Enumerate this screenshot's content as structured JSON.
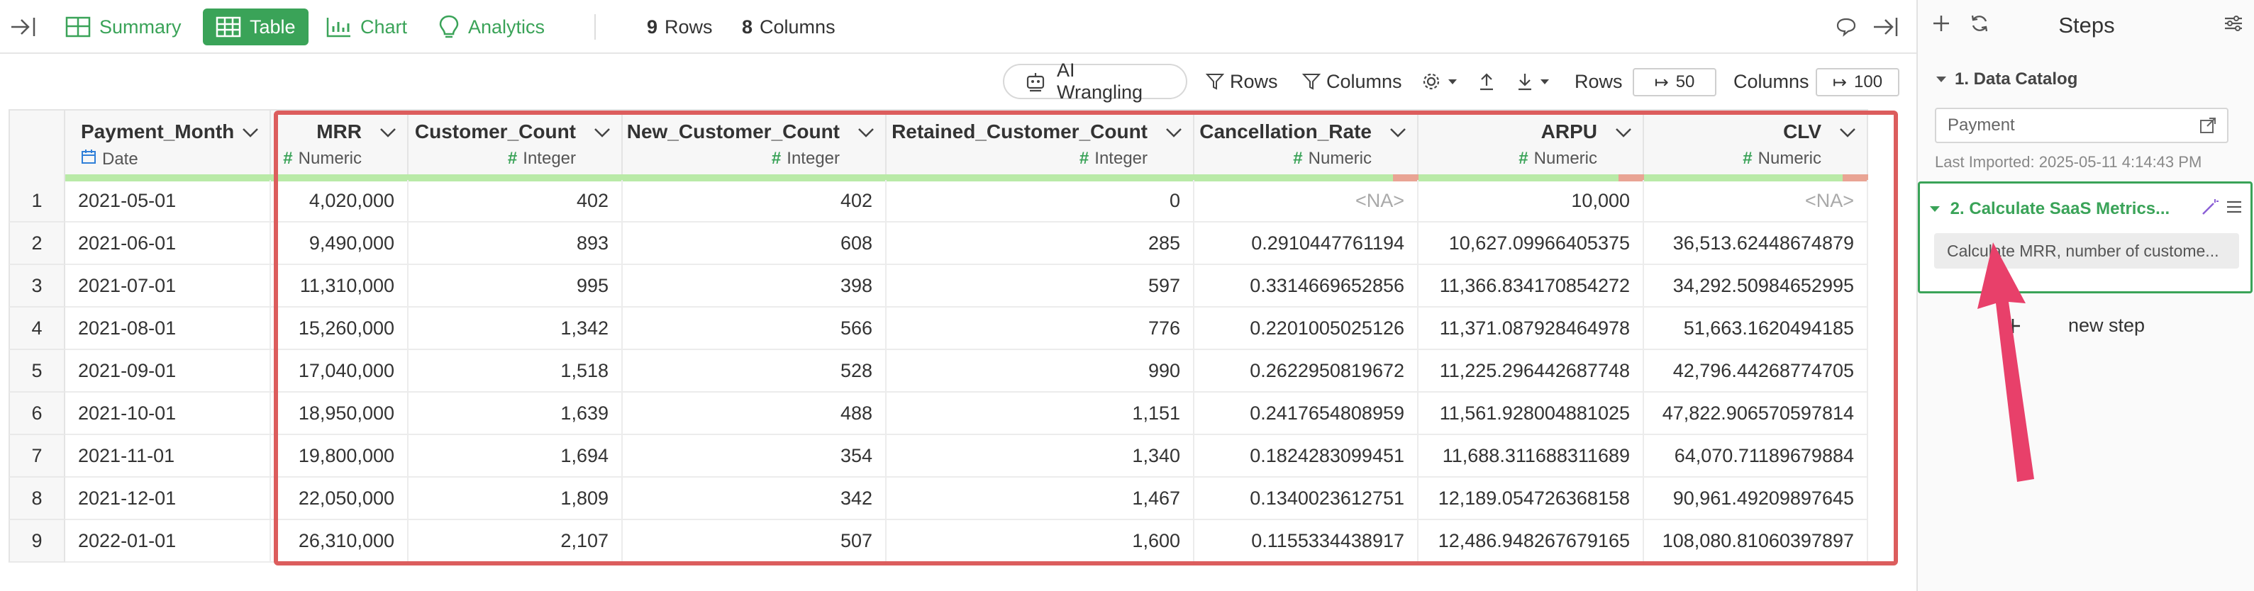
{
  "toolbar": {
    "tabs": [
      {
        "label": "Summary",
        "icon": "summary-icon"
      },
      {
        "label": "Table",
        "icon": "table-icon",
        "active": true
      },
      {
        "label": "Chart",
        "icon": "chart-icon"
      },
      {
        "label": "Analytics",
        "icon": "analytics-icon"
      }
    ],
    "rows_count": "9",
    "rows_label": "Rows",
    "cols_count": "8",
    "cols_label": "Columns"
  },
  "toolbar2": {
    "ai_label": "AI Wrangling",
    "rows_filter": "Rows",
    "cols_filter": "Columns",
    "rows_label": "Rows",
    "rows_value": "50",
    "cols_label": "Columns",
    "cols_value": "100"
  },
  "table": {
    "columns": [
      {
        "name": "Payment_Month",
        "type": "Date"
      },
      {
        "name": "MRR",
        "type": "Numeric"
      },
      {
        "name": "Customer_Count",
        "type": "Integer"
      },
      {
        "name": "New_Customer_Count",
        "type": "Integer"
      },
      {
        "name": "Retained_Customer_Count",
        "type": "Integer"
      },
      {
        "name": "Cancellation_Rate",
        "type": "Numeric"
      },
      {
        "name": "ARPU",
        "type": "Numeric"
      },
      {
        "name": "CLV",
        "type": "Numeric"
      }
    ],
    "rows": [
      [
        "1",
        "2021-05-01",
        "4,020,000",
        "402",
        "402",
        "0",
        "<NA>",
        "10,000",
        "<NA>"
      ],
      [
        "2",
        "2021-06-01",
        "9,490,000",
        "893",
        "608",
        "285",
        "0.2910447761194",
        "10,627.09966405375",
        "36,513.62448674879"
      ],
      [
        "3",
        "2021-07-01",
        "11,310,000",
        "995",
        "398",
        "597",
        "0.3314669652856",
        "11,366.834170854272",
        "34,292.50984652995"
      ],
      [
        "4",
        "2021-08-01",
        "15,260,000",
        "1,342",
        "566",
        "776",
        "0.2201005025126",
        "11,371.087928464978",
        "51,663.1620494185"
      ],
      [
        "5",
        "2021-09-01",
        "17,040,000",
        "1,518",
        "528",
        "990",
        "0.2622950819672",
        "11,225.296442687748",
        "42,796.44268774705"
      ],
      [
        "6",
        "2021-10-01",
        "18,950,000",
        "1,639",
        "488",
        "1,151",
        "0.2417654808959",
        "11,561.928004881025",
        "47,822.906570597814"
      ],
      [
        "7",
        "2021-11-01",
        "19,800,000",
        "1,694",
        "354",
        "1,340",
        "0.1824283099451",
        "11,688.311688311689",
        "64,070.71189679884"
      ],
      [
        "8",
        "2021-12-01",
        "22,050,000",
        "1,809",
        "342",
        "1,467",
        "0.1340023612751",
        "12,189.054726368158",
        "90,961.49209897645"
      ],
      [
        "9",
        "2022-01-01",
        "26,310,000",
        "2,107",
        "507",
        "1,600",
        "0.1155334438917",
        "12,486.948267679165",
        "108,080.81060397897"
      ]
    ]
  },
  "sidebar": {
    "title": "Steps",
    "step1_title": "1. Data Catalog",
    "source_name": "Payment",
    "last_imported": "Last Imported: 2025-05-11 4:14:43 PM",
    "step2_title": "2. Calculate SaaS Metrics...",
    "step2_desc": "Calculate MRR, number of custome...",
    "add_step": "new step"
  },
  "colors": {
    "accent": "#3aa358",
    "highlight": "#dc5d5d"
  }
}
